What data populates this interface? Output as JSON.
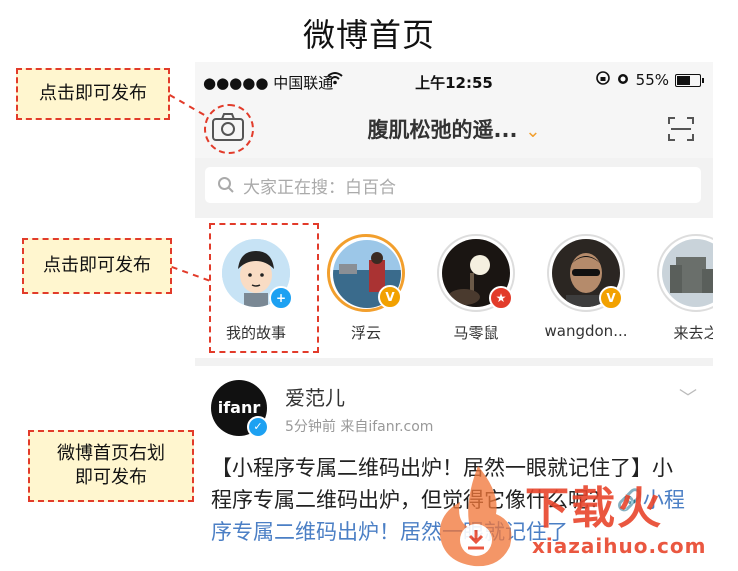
{
  "page_title": "微博首页",
  "status_bar": {
    "carrier": "●●●●● 中国联通",
    "time": "上午12:55",
    "battery_percent_text": "55%",
    "battery_level": 0.55
  },
  "navbar": {
    "title": "腹肌松弛的遥...",
    "chevron": "⌄"
  },
  "search": {
    "placeholder": "大家正在搜：白百合"
  },
  "stories": [
    {
      "name": "我的故事",
      "badge": "+",
      "badge_color": "#1da1f2",
      "ring": "none"
    },
    {
      "name": "浮云",
      "badge": "V",
      "badge_color": "#f2a100",
      "ring": "orange"
    },
    {
      "name": "马零鼠",
      "badge": "★",
      "badge_color": "#e23b2a",
      "ring": "gray"
    },
    {
      "name": "wangdon...",
      "badge": "V",
      "badge_color": "#f2a100",
      "ring": "gray"
    },
    {
      "name": "来去之",
      "badge": "",
      "badge_color": "",
      "ring": "gray"
    }
  ],
  "post": {
    "avatar_text": "ifanr",
    "author": "爱范儿",
    "meta": "5分钟前  来自ifanr.com",
    "body_text": "【小程序专属二维码出炉！居然一眼就记住了】小程序专属二维码出炉，但觉得它像什么呢？",
    "link_text": "小程序专属二维码出炉！居然一眼就记住了"
  },
  "callouts": {
    "camera": "点击即可发布",
    "story": "点击即可发布",
    "swipe_line1": "微博首页右划",
    "swipe_line2": "即可发布"
  },
  "watermark": {
    "text": "下载火",
    "sub": "xiazaihuo.com"
  },
  "colors": {
    "accent": "#f29f2d",
    "annotation": "#e23b2a",
    "callout_bg": "#fff6cf",
    "link": "#4b7fc5"
  }
}
